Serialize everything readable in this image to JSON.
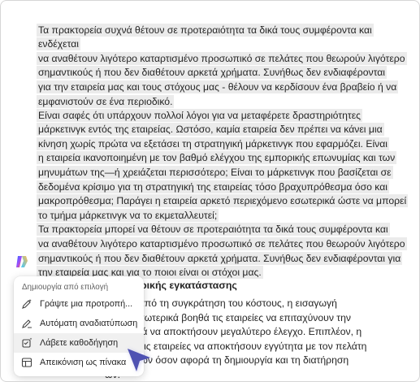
{
  "document": {
    "para1": "Τα πρακτορεία συχνά θέτουν σε προτεραιότητα τα δικά τους συμφέροντα και ενδέχεται\nνα αναθέτουν λιγότερο καταρτισμένο προσωπικό σε πελάτες που θεωρούν λιγότερο\nσημαντικούς ή που δεν διαθέτουν αρκετά χρήματα. Συνήθως δεν ενδιαφέρονται\nγια την εταιρεία μας και τους στόχους μας - θέλουν να κερδίσουν ένα βραβείο ή να\nεμφανιστούν σε ένα περιοδικό.",
    "para2": "Είναι σαφές ότι υπάρχουν πολλοί λόγοι για να μεταφέρετε δραστηριότητες\nμάρκετινγκ εντός της εταιρείας. Ωστόσο, καμία εταιρεία δεν πρέπει να κάνει μια\nκίνηση χωρίς πρώτα να εξετάσει τη στρατηγική μάρκετινγκ που εφαρμόζει. Είναι\nη εταιρεία ικανοποιημένη με τον βαθμό ελέγχου της εμπορικής επωνυμίας και των\nμηνυμάτων της—ή χρειάζεται περισσότερο; Είναι το μάρκετινγκ που βασίζεται σε\nδεδομένα κρίσιμο για τη στρατηγική της εταιρείας τόσο βραχυπρόθεσμα όσο και\nμακροπρόθεσμα; Παράγει η εταιρεία αρκετό περιεχόμενο εσωτερικά ώστε να μπορεί\nτο τμήμα μάρκετινγκ να το εκμεταλλευτεί;\nΤα πρακτορεία μπορεί να θέτουν σε προτεραιότητα τα δικά τους συμφέροντα και\nνα αναθέτουν λιγότερο καταρτισμένο προσωπικό σε πελάτες που θεωρούν λιγότερο\nσημαντικούς ή που δεν διαθέτουν αρκετά χρήματα. Συνήθως δεν ενδιαφέρονται για\nτην εταιρεία μας και για το ποιοι είναι οι στόχοι μας.",
    "heading": "ή εξωτερικής εγκατάστασης",
    "para3": "; Εκτός από τη συγκράτηση του κόστους, η εισαγωγή\nκτικής εσωτερικά βοηθά τις εταιρείες να επιταχύνουν την\nκαι γενικά να αποκτήσουν μεγαλύτερο έλεγχο. Επιπλέον, η\nκολυθεί τις εταιρείες να αποκτήσουν εγγύτητα με τον πελάτη\nργανισμών όσον αφορά τη δημιουργία και τη διατήρηση\nων."
  },
  "menu": {
    "header": "Δημιουργία από επιλογή",
    "items": [
      {
        "label": "Γράψτε μια προτροπή...",
        "icon": "pen-sparkle-icon"
      },
      {
        "label": "Αυτόματη αναδιατύπωση",
        "icon": "rewrite-icon"
      },
      {
        "label": "Λάβετε καθοδήγηση",
        "icon": "guidance-icon"
      },
      {
        "label": "Απεικόνιση ως πίνακα",
        "icon": "table-icon"
      }
    ],
    "active_index": 2
  },
  "colors": {
    "selection": "#ebebeb",
    "cursor": "#4f52b2",
    "menu_active": "#f0f0f0"
  }
}
